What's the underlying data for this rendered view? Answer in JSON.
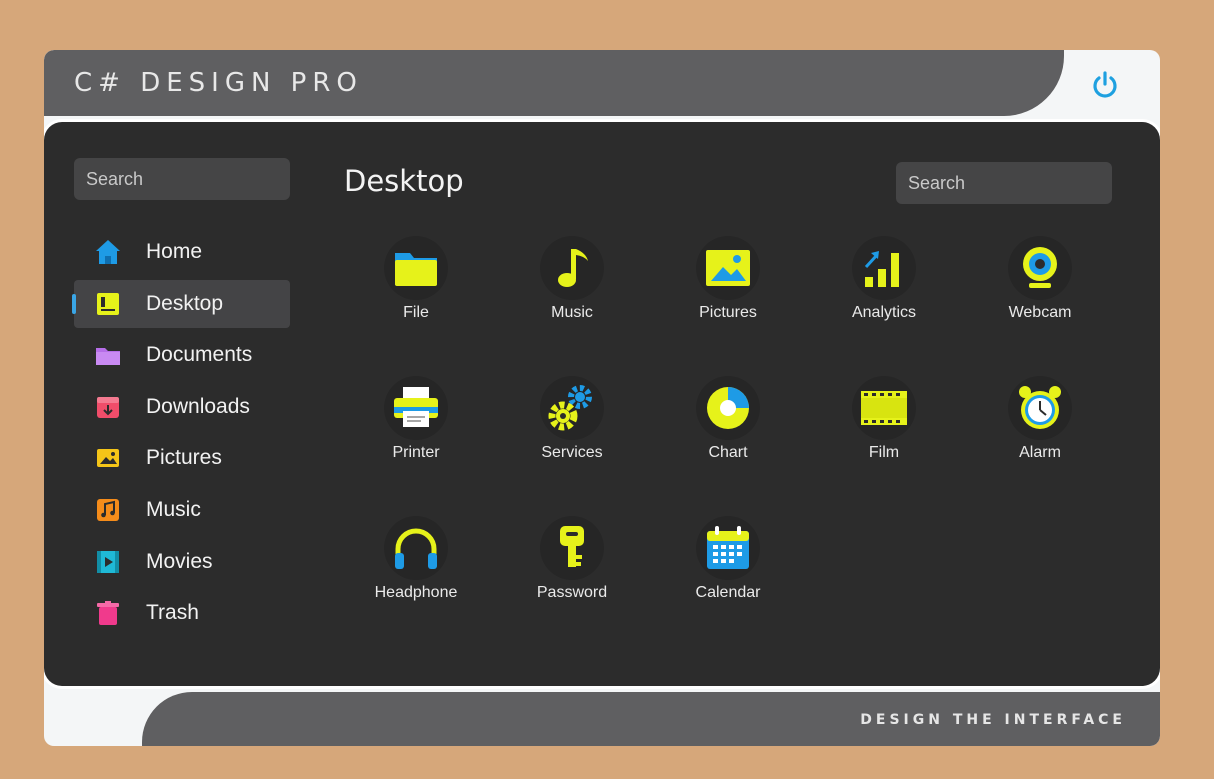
{
  "app": {
    "title": "C# DESIGN PRO",
    "tagline": "DESIGN THE INTERFACE"
  },
  "sidebar": {
    "search_placeholder": "Search",
    "items": [
      {
        "label": "Home",
        "icon": "home-icon",
        "color": "#1e9be6"
      },
      {
        "label": "Desktop",
        "icon": "desktop-icon",
        "color": "#e6f21a",
        "active": true
      },
      {
        "label": "Documents",
        "icon": "folder-icon",
        "color": "#b66ee8"
      },
      {
        "label": "Downloads",
        "icon": "download-icon",
        "color": "#f04d6a"
      },
      {
        "label": "Pictures",
        "icon": "picture-icon",
        "color": "#f5c518"
      },
      {
        "label": "Music",
        "icon": "music-icon",
        "color": "#f58c1a"
      },
      {
        "label": "Movies",
        "icon": "movie-icon",
        "color": "#1fb9d6"
      },
      {
        "label": "Trash",
        "icon": "trash-icon",
        "color": "#f03a8c"
      }
    ]
  },
  "main": {
    "title": "Desktop",
    "search_placeholder": "Search",
    "tiles": [
      {
        "label": "File",
        "icon": "file-folder-icon"
      },
      {
        "label": "Music",
        "icon": "music-note-icon"
      },
      {
        "label": "Pictures",
        "icon": "pictures-icon"
      },
      {
        "label": "Analytics",
        "icon": "analytics-icon"
      },
      {
        "label": "Webcam",
        "icon": "webcam-icon"
      },
      {
        "label": "Printer",
        "icon": "printer-icon"
      },
      {
        "label": "Services",
        "icon": "gears-icon"
      },
      {
        "label": "Chart",
        "icon": "pie-chart-icon"
      },
      {
        "label": "Film",
        "icon": "film-icon"
      },
      {
        "label": "Alarm",
        "icon": "alarm-clock-icon"
      },
      {
        "label": "Headphone",
        "icon": "headphone-icon"
      },
      {
        "label": "Password",
        "icon": "key-icon"
      },
      {
        "label": "Calendar",
        "icon": "calendar-icon"
      }
    ]
  },
  "colors": {
    "accent_yellow": "#e6f21a",
    "accent_blue": "#3aa6e6",
    "panel": "#2c2c2c",
    "titlebar": "#5f5f61",
    "background": "#d6a77a"
  }
}
